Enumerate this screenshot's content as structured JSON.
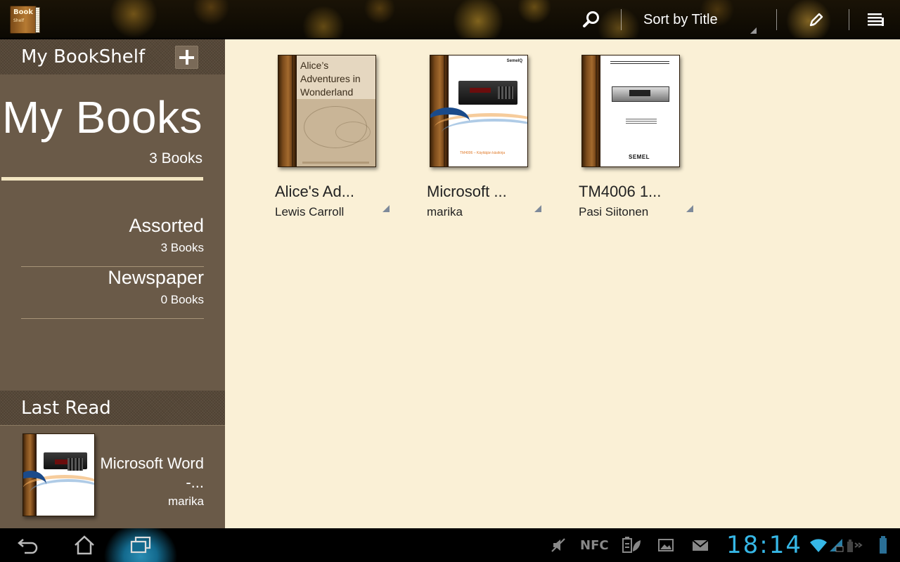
{
  "app": {
    "icon_title": "Book",
    "icon_subtitle": "Shelf"
  },
  "actionbar": {
    "sort_label": "Sort by Title"
  },
  "sidebar": {
    "shelf_header": "My BookShelf",
    "my_books": {
      "title": "My Books",
      "count": "3 Books"
    },
    "shelves": [
      {
        "name": "Assorted",
        "count": "3 Books"
      },
      {
        "name": "Newspaper",
        "count": "0 Books"
      }
    ],
    "last_read": {
      "header": "Last Read",
      "title": "Microsoft Word -...",
      "author": "marika"
    }
  },
  "books": [
    {
      "title": "Alice's Ad...",
      "author": "Lewis Carroll",
      "cover_text": "Alice’s Adventures in Wonderland"
    },
    {
      "title": "Microsoft ...",
      "author": "marika",
      "cover_brand": "SemelQ",
      "cover_caption": "TM4006 – Käyttäjän käsikirja"
    },
    {
      "title": "TM4006 1...",
      "author": "Pasi Siitonen",
      "cover_brand": "SEMEL"
    }
  ],
  "statusbar": {
    "clock": "18:14",
    "nfc_label": "NFC"
  },
  "colors": {
    "main_bg": "#faf0d6",
    "sidebar_bg": "#6a5a48",
    "clock": "#36b7e6",
    "underline": "#f3e6c2"
  }
}
